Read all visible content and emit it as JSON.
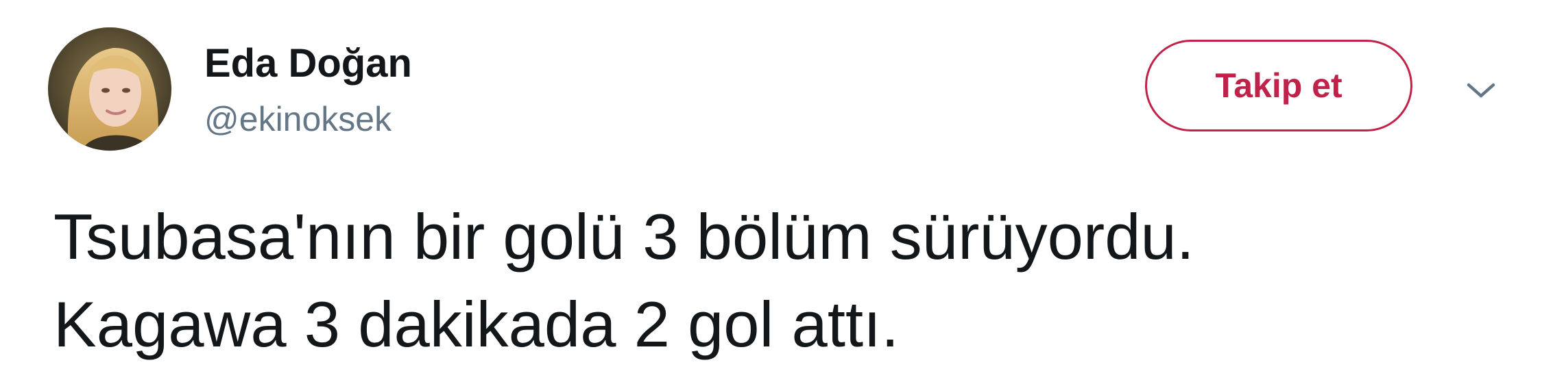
{
  "author": {
    "display_name": "Eda Doğan",
    "handle": "@ekinoksek"
  },
  "actions": {
    "follow_label": "Takip et",
    "more_icon": "chevron-down-icon"
  },
  "tweet": {
    "lines": [
      "Tsubasa'nın bir golü 3 bölüm sürüyordu.",
      "Kagawa 3 dakikada 2 gol attı."
    ]
  },
  "colors": {
    "accent": "#c0224a",
    "text": "#14171a",
    "secondary_text": "#657786",
    "caret": "#657786"
  }
}
